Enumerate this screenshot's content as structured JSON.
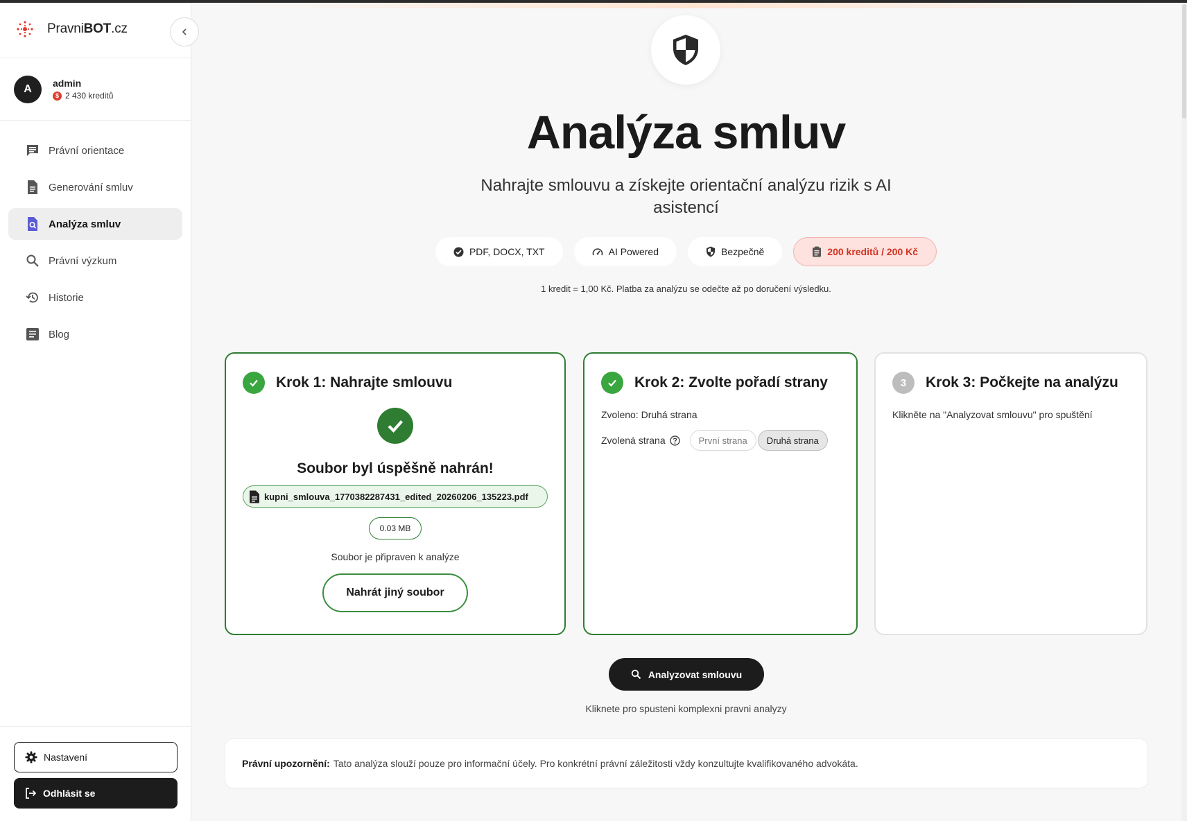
{
  "brand": {
    "name_light": "Pravni",
    "name_bold": "BOT",
    "name_suffix": ".cz",
    "accent": "#e03b2c"
  },
  "user": {
    "avatar_letter": "A",
    "name": "admin",
    "credits": "2 430 kreditů"
  },
  "sidebar": {
    "items": [
      {
        "label": "Právní orientace",
        "icon": "chat-lines-icon"
      },
      {
        "label": "Generování smluv",
        "icon": "document-icon"
      },
      {
        "label": "Analýza smluv",
        "icon": "document-search-icon",
        "active": true
      },
      {
        "label": "Právní výzkum",
        "icon": "search-icon"
      },
      {
        "label": "Historie",
        "icon": "history-icon"
      },
      {
        "label": "Blog",
        "icon": "article-icon"
      }
    ],
    "settings_label": "Nastavení",
    "logout_label": "Odhlásit se"
  },
  "header": {
    "title": "Analýza smluv",
    "subtitle": "Nahrajte smlouvu a získejte orientační analýzu rizik s AI asistencí",
    "chips": [
      "PDF, DOCX, TXT",
      "AI Powered",
      "Bezpečně",
      "200 kreditů / 200 Kč"
    ],
    "note": "1 kredit = 1,00 Kč. Platba za analýzu se odečte až po doručení výsledku."
  },
  "step1": {
    "title": "Krok 1: Nahrajte smlouvu",
    "success": "Soubor byl úspěšně nahrán!",
    "filename": "kupni_smlouva_1770382287431_edited_20260206_135223.pdf",
    "size": "0.03 MB",
    "ready": "Soubor je připraven k analýze",
    "reupload_label": "Nahrát jiný soubor"
  },
  "step2": {
    "title": "Krok 2: Zvolte pořadí strany",
    "chosen": "Zvoleno: Druhá strana",
    "side_label": "Zvolená strana",
    "option_first": "První strana",
    "option_second": "Druhá strana"
  },
  "step3": {
    "number": "3",
    "title": "Krok 3: Počkejte na analýzu",
    "hint": "Klikněte na \"Analyzovat smlouvu\" pro spuštění"
  },
  "analyze": {
    "button_label": "Analyzovat smlouvu",
    "hint": "Kliknete pro spusteni komplexni pravni analyzy"
  },
  "disclaimer": {
    "label": "Právní upozornění:",
    "text": "Tato analýza slouží pouze pro informační účely. Pro konkrétní právní záležitosti vždy konzultujte kvalifikovaného advokáta."
  },
  "colors": {
    "success": "#2f7d32",
    "price_text": "#d2321f",
    "dark": "#1c1c1c"
  }
}
